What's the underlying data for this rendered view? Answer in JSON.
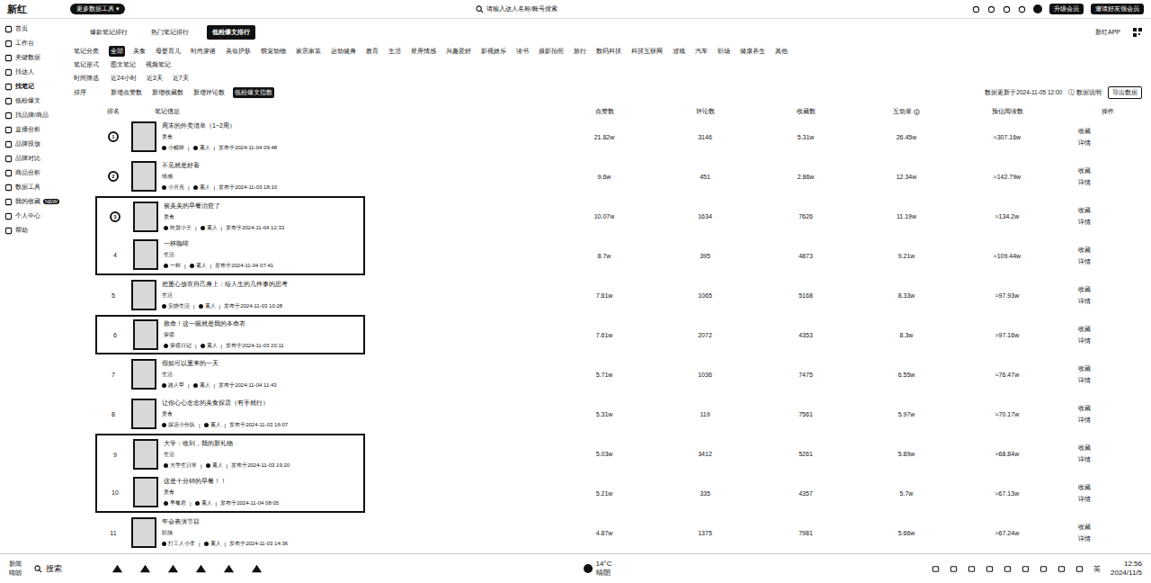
{
  "app": {
    "logo": "新红",
    "tool_menu": "更多数据工具",
    "tool_menu_arrow": "▾",
    "search_placeholder": "请输入达人名称/账号搜索",
    "header_buttons": [
      "升级会员",
      "邀请好友领会员"
    ]
  },
  "sidebar": {
    "items": [
      {
        "label": "首页",
        "badge": "",
        "selected": false
      },
      {
        "label": "工作台",
        "badge": "",
        "selected": false
      },
      {
        "label": "关键数据",
        "badge": "",
        "selected": false
      },
      {
        "label": "找达人",
        "badge": "",
        "selected": false
      },
      {
        "label": "找笔记",
        "badge": "",
        "selected": true
      },
      {
        "label": "低粉爆文",
        "badge": "",
        "selected": false
      },
      {
        "label": "找品牌/商品",
        "badge": "",
        "selected": false
      },
      {
        "label": "直播分析",
        "badge": "",
        "selected": false
      },
      {
        "label": "品牌投放",
        "badge": "",
        "selected": false
      },
      {
        "label": "品牌对比",
        "badge": "",
        "selected": false
      },
      {
        "label": "商品分析",
        "badge": "",
        "selected": false
      },
      {
        "label": "数据工具",
        "badge": "",
        "selected": false
      },
      {
        "label": "我的收藏",
        "badge": "NEW",
        "selected": false
      },
      {
        "label": "个人中心",
        "badge": "",
        "selected": false
      },
      {
        "label": "帮助",
        "badge": "",
        "selected": false
      }
    ]
  },
  "tabs": [
    {
      "label": "爆款笔记排行",
      "selected": false
    },
    {
      "label": "热门笔记排行",
      "selected": false
    },
    {
      "label": "低粉爆文排行",
      "selected": true
    }
  ],
  "side_link": "新红APP",
  "filters": [
    {
      "label": "笔记分类",
      "options": [
        {
          "label": "全部",
          "selected": true
        },
        {
          "label": "美食",
          "selected": false
        },
        {
          "label": "母婴育儿",
          "selected": false
        },
        {
          "label": "时尚穿搭",
          "selected": false
        },
        {
          "label": "美妆护肤",
          "selected": false
        },
        {
          "label": "萌宠动物",
          "selected": false
        },
        {
          "label": "家居家装",
          "selected": false
        },
        {
          "label": "运动健身",
          "selected": false
        },
        {
          "label": "教育",
          "selected": false
        },
        {
          "label": "生活",
          "selected": false
        },
        {
          "label": "星座情感",
          "selected": false
        },
        {
          "label": "兴趣爱好",
          "selected": false
        },
        {
          "label": "影视娱乐",
          "selected": false
        },
        {
          "label": "读书",
          "selected": false
        },
        {
          "label": "摄影拍照",
          "selected": false
        },
        {
          "label": "旅行",
          "selected": false
        },
        {
          "label": "数码科技",
          "selected": false
        },
        {
          "label": "科技互联网",
          "selected": false
        },
        {
          "label": "游戏",
          "selected": false
        },
        {
          "label": "汽车",
          "selected": false
        },
        {
          "label": "职场",
          "selected": false
        },
        {
          "label": "健康养生",
          "selected": false
        },
        {
          "label": "其他",
          "selected": false
        }
      ]
    },
    {
      "label": "笔记形式",
      "options": [
        {
          "label": "图文笔记",
          "selected": false
        },
        {
          "label": "视频笔记",
          "selected": false
        }
      ]
    },
    {
      "label": "时间筛选",
      "options": [
        {
          "label": "近24小时",
          "selected": false
        },
        {
          "label": "近3天",
          "selected": false
        },
        {
          "label": "近7天",
          "selected": false
        }
      ]
    }
  ],
  "sort": {
    "label": "排序",
    "options": [
      {
        "label": "新增点赞数",
        "selected": false
      },
      {
        "label": "新增收藏数",
        "selected": false
      },
      {
        "label": "新增评论数",
        "selected": false
      },
      {
        "label": "低粉爆文指数",
        "selected": true
      }
    ]
  },
  "update_time": "数据更新于2024-11-05 12:00",
  "update_hint": "ⓘ 数据说明",
  "export_button": "导出数据",
  "table": {
    "columns": [
      {
        "label": "排名",
        "info": false
      },
      {
        "label": "笔记信息",
        "info": false
      },
      {
        "label": "点赞数",
        "info": false
      },
      {
        "label": "评论数",
        "info": false
      },
      {
        "label": "收藏数",
        "info": false
      },
      {
        "label": "互动量",
        "info": true
      },
      {
        "label": "预估阅读数",
        "info": false
      },
      {
        "label": "操作",
        "info": false
      }
    ],
    "rows": [
      {
        "rank": "1",
        "kind": "medal",
        "boxed": false,
        "title": "周末的外卖清单（1~2周）",
        "tag": "美食",
        "author": "小糖咪",
        "fans": "素人",
        "time": "发布于2024-11-04 09:48",
        "likes": "21.82w",
        "comments": "3146",
        "collects": "5.31w",
        "interactions": "26.45w",
        "reads": "≈307.16w"
      },
      {
        "rank": "2",
        "kind": "medal",
        "boxed": false,
        "title": "不见就是好看",
        "tag": "情感",
        "author": "小月亮",
        "fans": "素人",
        "time": "发布于2024-11-03 18:10",
        "likes": "9.6w",
        "comments": "451",
        "collects": "2.86w",
        "interactions": "12.34w",
        "reads": "≈142.79w"
      },
      {
        "rank": "3",
        "kind": "medal",
        "boxed": true,
        "title": "被美美的早餐治愈了",
        "tag": "美食",
        "author": "吃货小王",
        "fans": "素人",
        "time": "发布于2024-11-04 12:33",
        "likes": "10.07w",
        "comments": "1634",
        "collects": "7626",
        "interactions": "11.19w",
        "reads": "≈134.2w"
      },
      {
        "rank": "4",
        "kind": "number",
        "boxed": true,
        "title": "一杯咖啡",
        "tag": "生活",
        "author": "一杯",
        "fans": "素人",
        "time": "发布于2024-11-04 07:41",
        "likes": "8.7w",
        "comments": "395",
        "collects": "4873",
        "interactions": "9.21w",
        "reads": "≈109.44w"
      },
      {
        "rank": "5",
        "kind": "number",
        "boxed": false,
        "title": "把重心放在自己身上：给人生的几件事的思考",
        "tag": "生活",
        "author": "安静生活",
        "fans": "素人",
        "time": "发布于2024-11-03 10:28",
        "likes": "7.61w",
        "comments": "1065",
        "collects": "5168",
        "interactions": "8.33w",
        "reads": "≈97.93w"
      },
      {
        "rank": "6",
        "kind": "number",
        "boxed": true,
        "title": "救命！这一眼就是我的本命衣",
        "tag": "穿搭",
        "author": "穿搭日记",
        "fans": "素人",
        "time": "发布于2024-11-03 20:11",
        "likes": "7.61w",
        "comments": "2072",
        "collects": "4353",
        "interactions": "8.3w",
        "reads": "≈97.16w"
      },
      {
        "rank": "7",
        "kind": "number",
        "boxed": false,
        "title": "假如可以重来的一天",
        "tag": "生活",
        "author": "路人甲",
        "fans": "素人",
        "time": "发布于2024-11-04 11:43",
        "likes": "5.71w",
        "comments": "1036",
        "collects": "7475",
        "interactions": "6.55w",
        "reads": "≈76.47w"
      },
      {
        "rank": "8",
        "kind": "number",
        "boxed": false,
        "title": "让你心心念念的美食探店（有手就行）",
        "tag": "美食",
        "author": "探店小分队",
        "fans": "素人",
        "time": "发布于2024-11-03 16:07",
        "likes": "5.31w",
        "comments": "119",
        "collects": "7561",
        "interactions": "5.97w",
        "reads": "≈70.17w"
      },
      {
        "rank": "9",
        "kind": "number",
        "boxed": true,
        "title": "大学：收到，我的新礼物",
        "tag": "生活",
        "author": "大学生日常",
        "fans": "素人",
        "time": "发布于2024-11-03 19:20",
        "likes": "5.03w",
        "comments": "3412",
        "collects": "5261",
        "interactions": "5.89w",
        "reads": "≈68.84w"
      },
      {
        "rank": "10",
        "kind": "number",
        "boxed": true,
        "title": "这是十分钟的早餐！！",
        "tag": "美食",
        "author": "早餐君",
        "fans": "素人",
        "time": "发布于2024-11-04 08:05",
        "likes": "5.21w",
        "comments": "335",
        "collects": "4357",
        "interactions": "5.7w",
        "reads": "≈67.13w"
      },
      {
        "rank": "11",
        "kind": "number",
        "boxed": false,
        "title": "年会表演节目",
        "tag": "职场",
        "author": "打工人小李",
        "fans": "素人",
        "time": "发布于2024-11-03 14:36",
        "likes": "4.87w",
        "comments": "1375",
        "collects": "7981",
        "interactions": "5.66w",
        "reads": "≈67.24w"
      }
    ],
    "actions": [
      "收藏",
      "详情"
    ]
  },
  "taskbar": {
    "news": "新闻",
    "news_sub": "晴朗",
    "search": "搜索",
    "weather_temp": "14°C",
    "weather_text": "晴朗",
    "ime": "英",
    "time": "12:56",
    "date": "2024/11/5"
  }
}
